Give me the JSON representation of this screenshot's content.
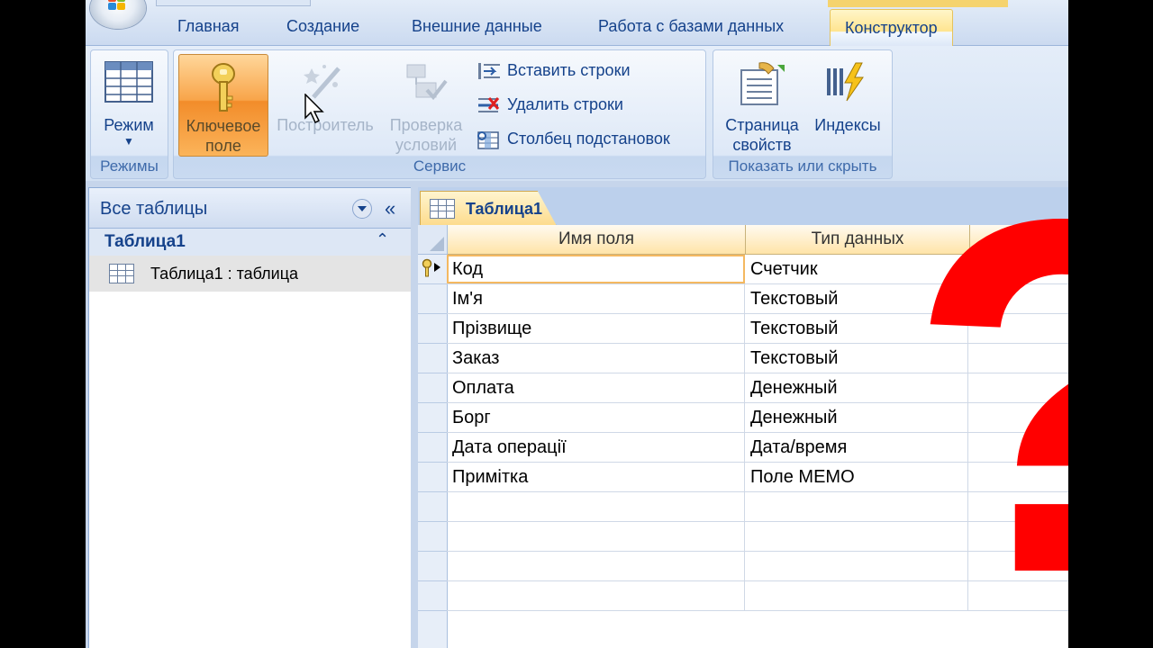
{
  "ribbon_tabs": [
    "Главная",
    "Создание",
    "Внешние данные",
    "Работа с базами данных",
    "Конструктор"
  ],
  "active_tab": "Конструктор",
  "ribbon": {
    "group_views": {
      "label": "Режимы",
      "view_button": "Режим"
    },
    "group_tools": {
      "label": "Сервис",
      "primary_key_line1": "Ключевое",
      "primary_key_line2": "поле",
      "builder": "Построитель",
      "test_line1": "Проверка",
      "test_line2": "условий",
      "insert_rows": "Вставить строки",
      "delete_rows": "Удалить строки",
      "lookup_column": "Столбец  подстановок"
    },
    "group_show_hide": {
      "label": "Показать или скрыть",
      "property_sheet_line1": "Страница",
      "property_sheet_line2": "свойств",
      "indexes": "Индексы"
    }
  },
  "nav_pane": {
    "title": "Все таблицы",
    "collapse_glyph": "«",
    "group_title": "Таблица1",
    "group_chevron": "⌃",
    "item_label": "Таблица1 : таблица"
  },
  "document": {
    "tab_label": "Таблица1",
    "columns": [
      "Имя поля",
      "Тип данных",
      ""
    ],
    "rows": [
      {
        "name": "Код",
        "type": "Счетчик",
        "primary_key": true
      },
      {
        "name": "Ім'я",
        "type": "Текстовый"
      },
      {
        "name": "Прізвище",
        "type": "Текстовый"
      },
      {
        "name": "Заказ",
        "type": "Текстовый"
      },
      {
        "name": "Оплата",
        "type": "Денежный"
      },
      {
        "name": "Борг",
        "type": "Денежный"
      },
      {
        "name": "Дата операції",
        "type": "Дата/время"
      },
      {
        "name": "Примітка",
        "type": "Поле MEMO"
      },
      {
        "name": "",
        "type": ""
      },
      {
        "name": "",
        "type": ""
      },
      {
        "name": "",
        "type": ""
      },
      {
        "name": "",
        "type": ""
      }
    ]
  },
  "overlay": {
    "glyph": "?",
    "color": "#ff0000"
  }
}
